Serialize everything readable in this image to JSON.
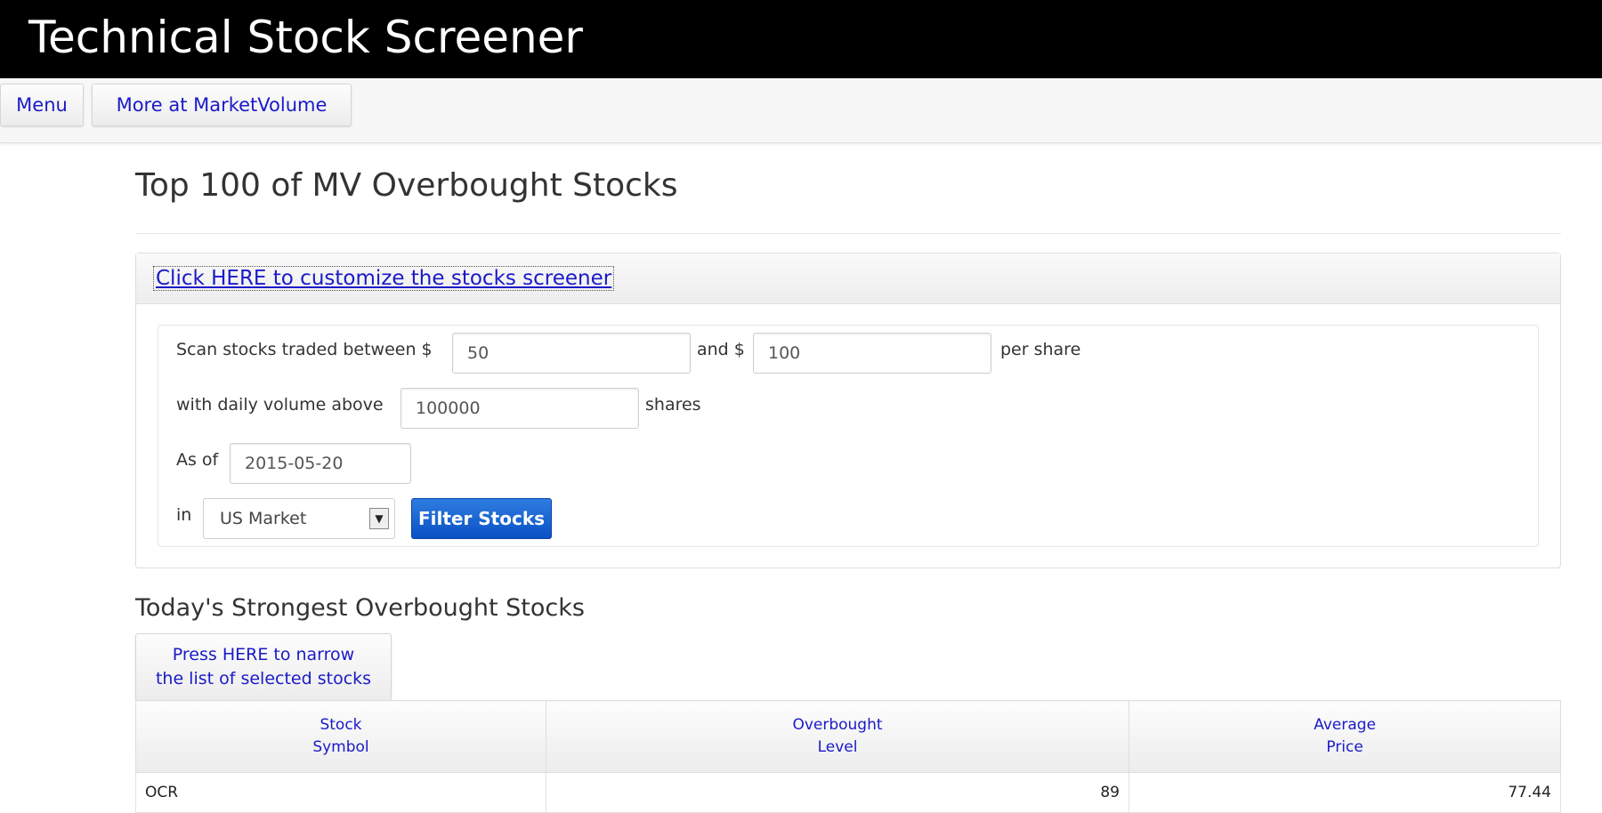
{
  "app": {
    "title": "Technical Stock Screener"
  },
  "nav": {
    "menu_label": "Menu",
    "more_label": "More at MarketVolume"
  },
  "page": {
    "title": "Top 100 of MV Overbought Stocks"
  },
  "customize": {
    "link_text": "Click HERE to customize the stocks screener"
  },
  "form": {
    "price_label": "Scan stocks traded between $",
    "min_price": "50",
    "and_label": "and $",
    "max_price": "100",
    "per_share_label": "per share",
    "volume_label": "with daily volume above",
    "volume": "100000",
    "shares_label": "shares",
    "asof_label": "As of",
    "date": "2015-05-20",
    "in_label": "in",
    "market": "US Market",
    "filter_button": "Filter Stocks"
  },
  "section": {
    "title": "Today's Strongest Overbought Stocks",
    "narrow_line1": "Press HERE to narrow",
    "narrow_line2": "the list of selected stocks"
  },
  "table": {
    "headers": [
      {
        "line1": "Stock",
        "line2": "Symbol"
      },
      {
        "line1": "Overbought",
        "line2": "Level"
      },
      {
        "line1": "Average",
        "line2": "Price"
      }
    ],
    "rows": [
      {
        "symbol": "OCR",
        "level": "89",
        "price": "77.44"
      }
    ]
  },
  "colors": {
    "link": "#1a1ac8",
    "header_bg": "#000000",
    "filter_button": "#0a50c4"
  }
}
